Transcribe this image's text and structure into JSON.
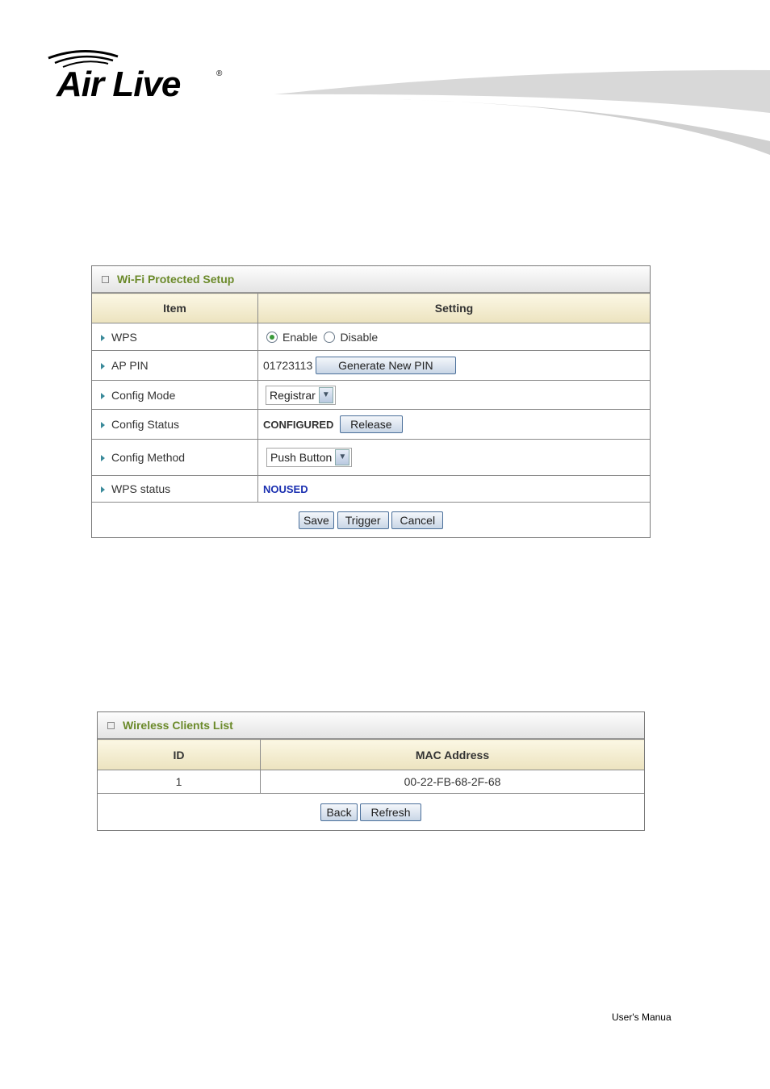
{
  "brand": {
    "logo_text": "Air Live",
    "registered": "®"
  },
  "wps_panel": {
    "title": "Wi-Fi Protected Setup",
    "headers": [
      "Item",
      "Setting"
    ],
    "rows": {
      "wps": {
        "label": "WPS",
        "options": [
          "Enable",
          "Disable"
        ],
        "selected": "Enable"
      },
      "ap_pin": {
        "label": "AP PIN",
        "value": "01723113",
        "button": "Generate New PIN"
      },
      "config_mode": {
        "label": "Config Mode",
        "value": "Registrar"
      },
      "config_status": {
        "label": "Config Status",
        "value": "CONFIGURED",
        "button": "Release"
      },
      "config_method": {
        "label": "Config Method",
        "value": "Push Button"
      },
      "wps_status": {
        "label": "WPS status",
        "value": "NOUSED"
      }
    },
    "buttons": {
      "save": "Save",
      "trigger": "Trigger",
      "cancel": "Cancel"
    }
  },
  "clients_panel": {
    "title": "Wireless Clients List",
    "headers": [
      "ID",
      "MAC Address"
    ],
    "rows": [
      {
        "id": "1",
        "mac": "00-22-FB-68-2F-68"
      }
    ],
    "buttons": {
      "back": "Back",
      "refresh": "Refresh"
    }
  },
  "footer": {
    "text": "User's Manua"
  },
  "colors": {
    "title_green": "#6b8a2a",
    "status_blue": "#1a2fb0",
    "header_bg": "#ece3bf"
  }
}
